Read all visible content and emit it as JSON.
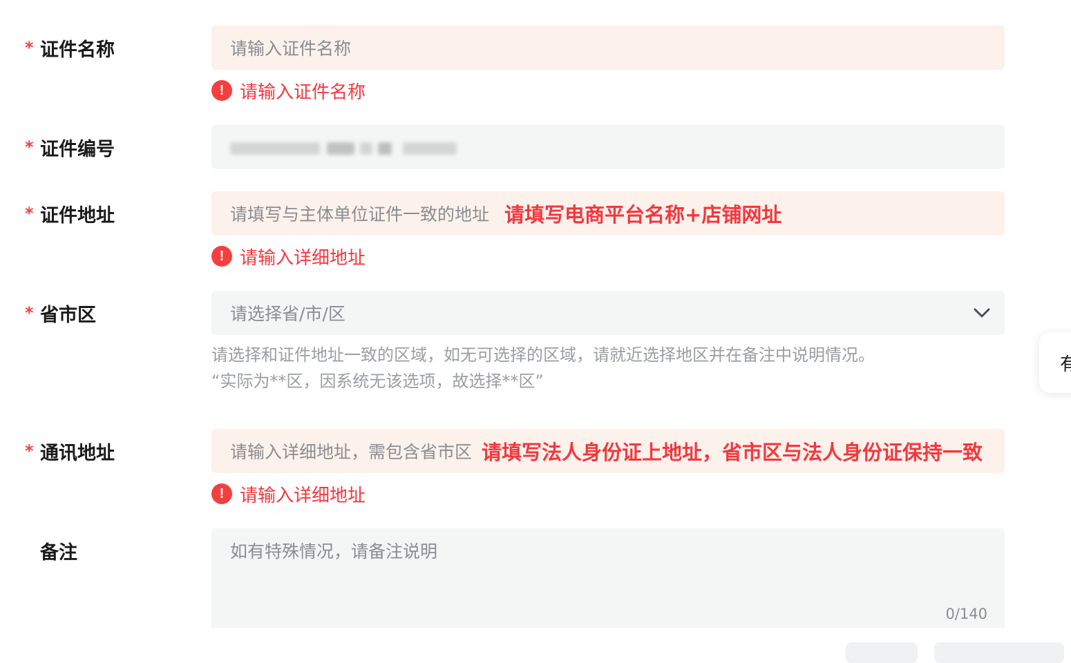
{
  "form": {
    "cert_name": {
      "label": "证件名称",
      "placeholder": "请输入证件名称",
      "error": "请输入证件名称"
    },
    "cert_number": {
      "label": "证件编号",
      "value_state": "blurred"
    },
    "cert_address": {
      "label": "证件地址",
      "placeholder": "请填写与主体单位证件一致的地址",
      "annotation": "请填写电商平台名称+店铺网址",
      "error": "请输入详细地址"
    },
    "region": {
      "label": "省市区",
      "placeholder": "请选择省/市/区",
      "hint_line1": "请选择和证件地址一致的区域，如无可选择的区域，请就近选择地区并在备注中说明情况。",
      "hint_line2": "“实际为**区，因系统无该选项，故选择**区”"
    },
    "contact_address": {
      "label": "通讯地址",
      "placeholder": "请输入详细地址，需包含省市区",
      "annotation": "请填写法人身份证上地址，省市区与法人身份证保持一致",
      "error": "请输入详细地址"
    },
    "remark": {
      "label": "备注",
      "placeholder": "如有特殊情况，请备注说明",
      "counter": "0/140"
    },
    "required_mark": "*",
    "error_icon_glyph": "!"
  },
  "side_card": {
    "text": "有"
  },
  "colors": {
    "error_red": "#f53f3f",
    "error_bg": "#fdf1ec",
    "input_bg": "#f4f5f5",
    "hint_gray": "#9a9da2"
  },
  "icons": {
    "error": "error-circle-icon",
    "dropdown": "chevron-down-icon"
  }
}
